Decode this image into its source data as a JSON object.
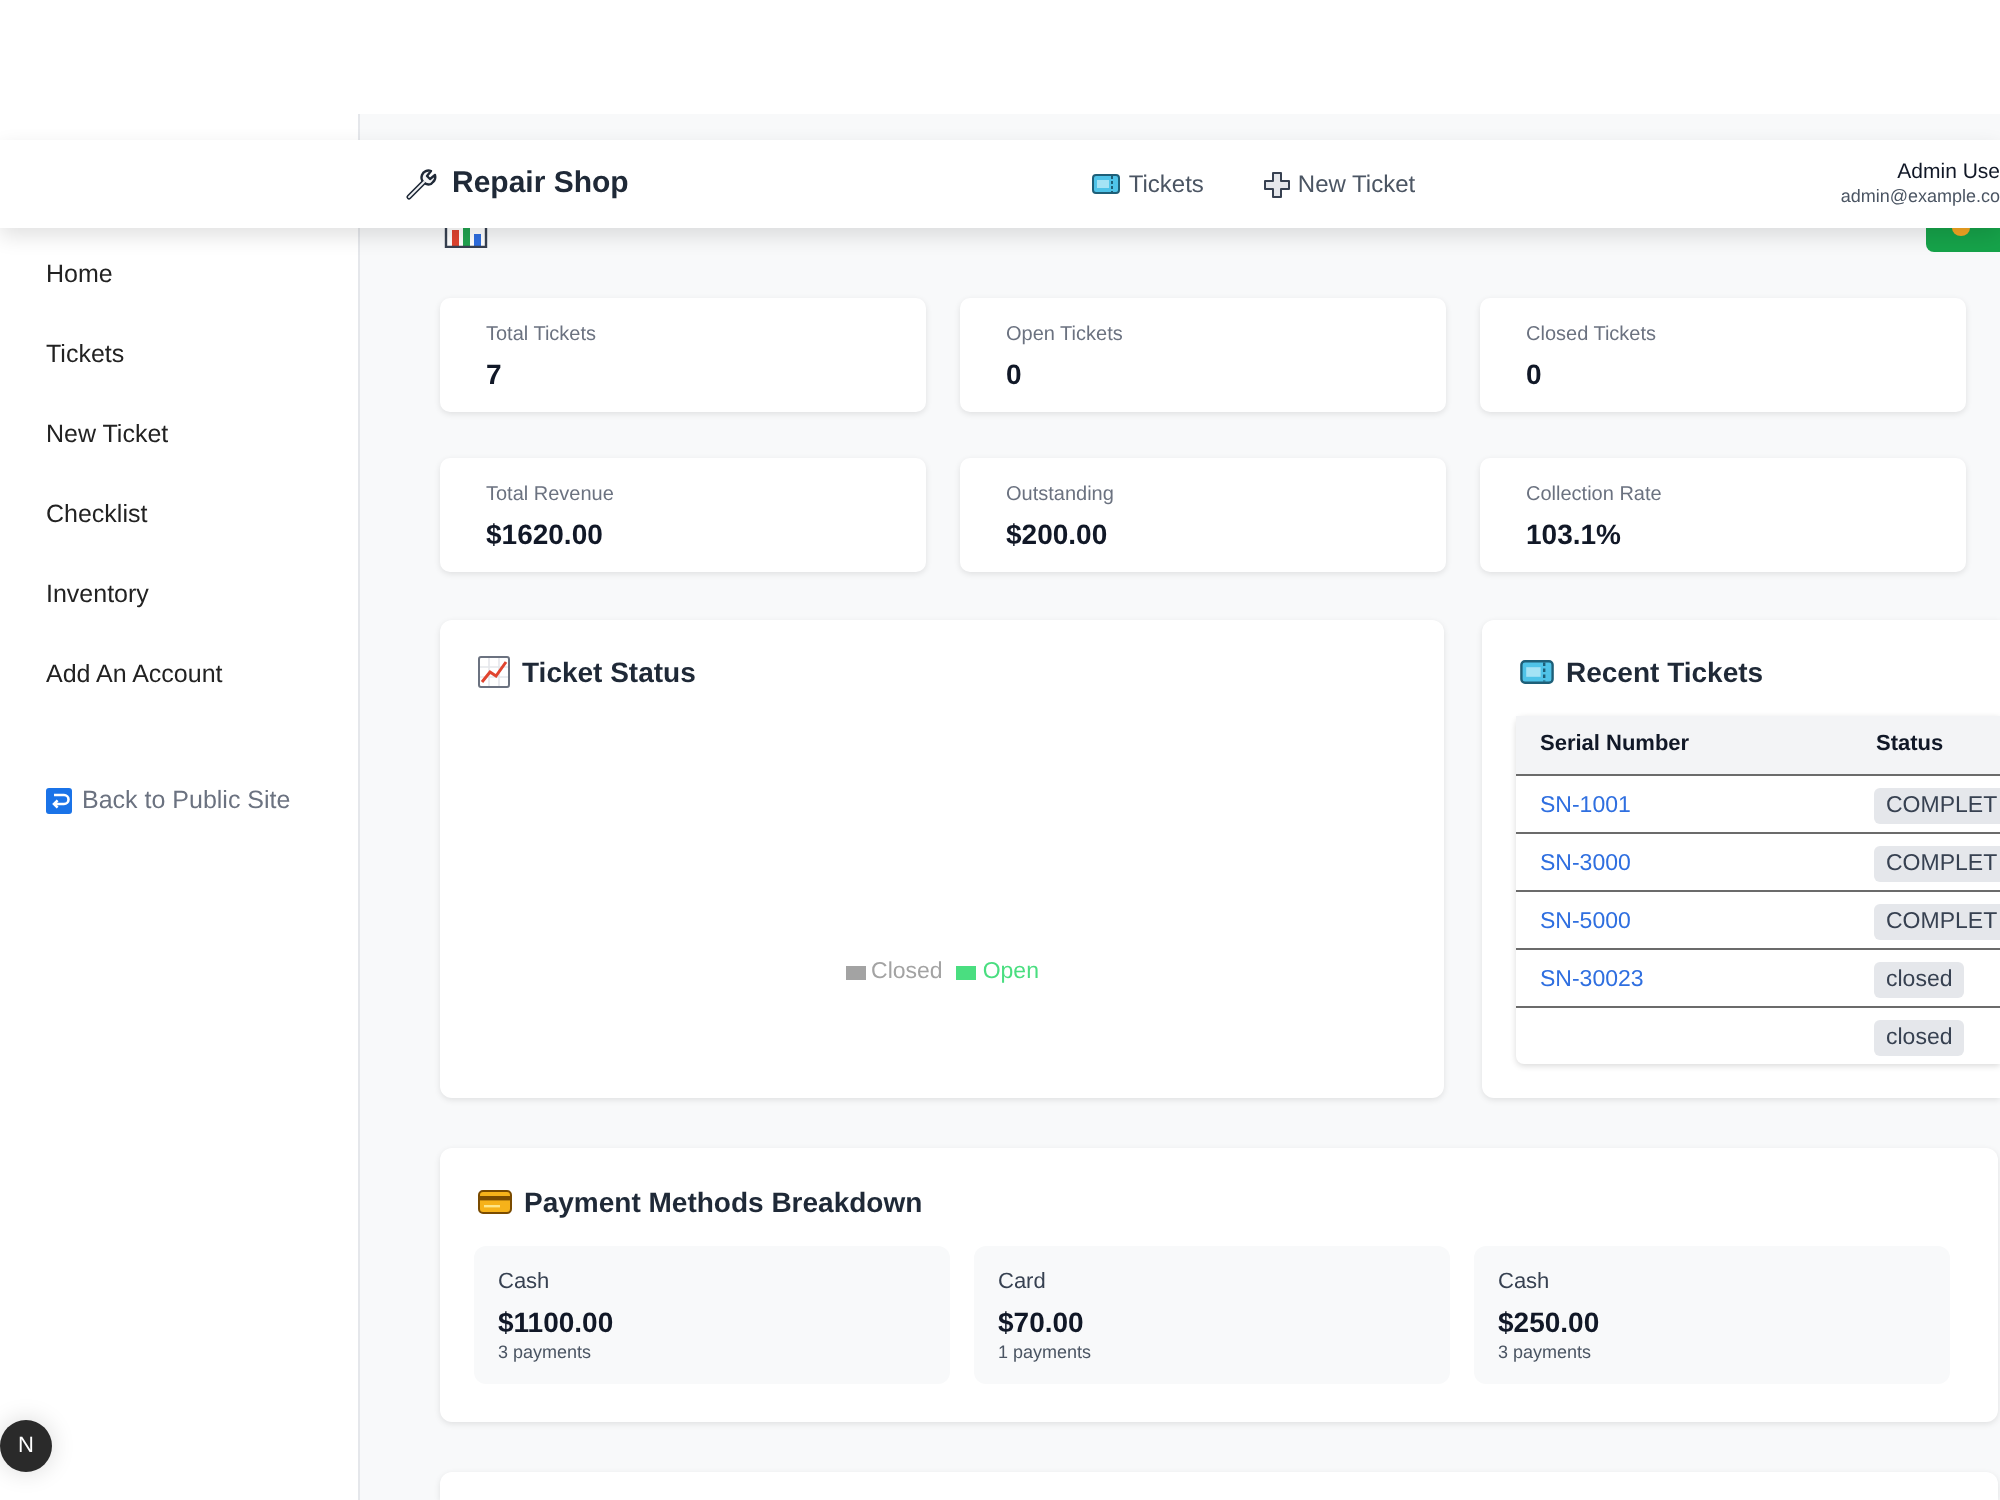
{
  "header": {
    "brand": "Repair Shop",
    "nav": [
      {
        "label": "Tickets"
      },
      {
        "label": "New Ticket"
      }
    ],
    "user": {
      "name": "Admin Use",
      "email": "admin@example.co"
    }
  },
  "sidebar": {
    "items": [
      {
        "label": "Home"
      },
      {
        "label": "Tickets"
      },
      {
        "label": "New Ticket"
      },
      {
        "label": "Checklist"
      },
      {
        "label": "Inventory"
      },
      {
        "label": "Add An Account"
      }
    ],
    "footer_link": {
      "label": "Back to Public Site"
    }
  },
  "stats": [
    {
      "label": "Total Tickets",
      "value": "7"
    },
    {
      "label": "Open Tickets",
      "value": "0"
    },
    {
      "label": "Closed Tickets",
      "value": "0"
    },
    {
      "label": "Total Revenue",
      "value": "$1620.00"
    },
    {
      "label": "Outstanding",
      "value": "$200.00"
    },
    {
      "label": "Collection Rate",
      "value": "103.1%"
    }
  ],
  "ticket_status": {
    "title": "Ticket Status",
    "legend": [
      {
        "label": "Closed",
        "color": "#a3a3a3"
      },
      {
        "label": "Open",
        "color": "#4ade80"
      }
    ]
  },
  "recent_tickets": {
    "title": "Recent Tickets",
    "columns": [
      "Serial Number",
      "Status"
    ],
    "rows": [
      {
        "serial": "SN-1001",
        "status": "COMPLET"
      },
      {
        "serial": "SN-3000",
        "status": "COMPLET"
      },
      {
        "serial": "SN-5000",
        "status": "COMPLET"
      },
      {
        "serial": "SN-30023",
        "status": "closed"
      },
      {
        "status": "closed"
      }
    ]
  },
  "payments": {
    "title": "Payment Methods Breakdown",
    "methods": [
      {
        "method": "Cash",
        "amount": "$1100.00",
        "count": "3 payments"
      },
      {
        "method": "Card",
        "amount": "$70.00",
        "count": "1 payments"
      },
      {
        "method": "Cash",
        "amount": "$250.00",
        "count": "3 payments"
      }
    ]
  },
  "dev_badge": {
    "label": "N"
  }
}
